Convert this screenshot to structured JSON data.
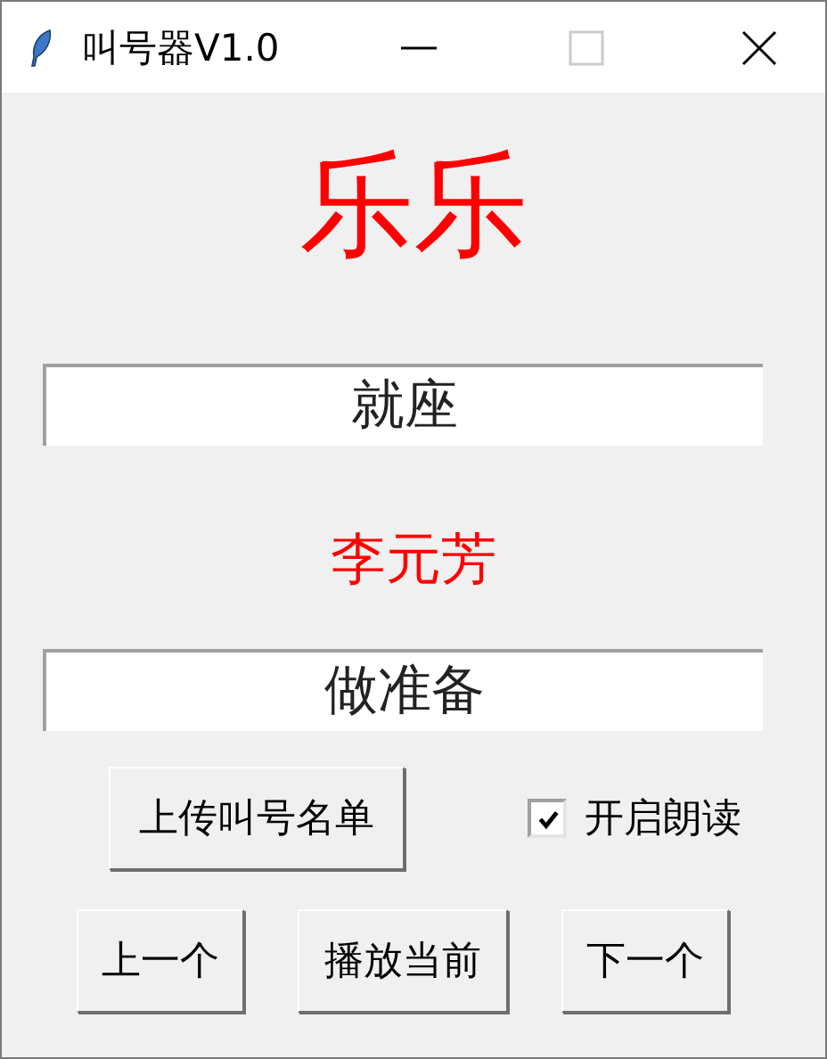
{
  "window": {
    "title": "叫号器V1.0"
  },
  "seated_name": "乐乐",
  "seated_field": {
    "value": "就座"
  },
  "next_name": "李元芳",
  "ready_field": {
    "value": "做准备"
  },
  "upload_button": "上传叫号名单",
  "read_aloud": {
    "label": "开启朗读",
    "checked": true
  },
  "buttons": [
    {
      "label": "上一个"
    },
    {
      "label": "播放当前"
    },
    {
      "label": "下一个"
    }
  ]
}
